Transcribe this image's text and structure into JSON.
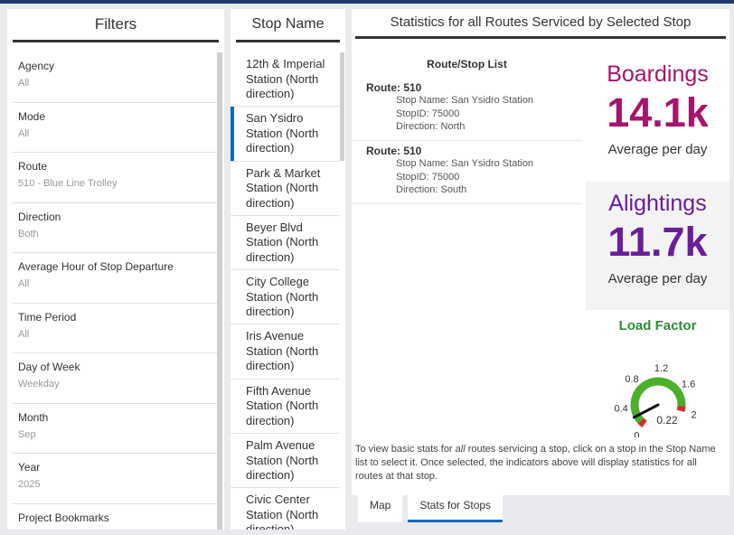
{
  "filters": {
    "title": "Filters",
    "items": [
      {
        "label": "Agency",
        "value": "All"
      },
      {
        "label": "Mode",
        "value": "All"
      },
      {
        "label": "Route",
        "value": "510 - Blue Line Trolley"
      },
      {
        "label": "Direction",
        "value": "Both"
      },
      {
        "label": "Average Hour of Stop Departure",
        "value": "All"
      },
      {
        "label": "Time Period",
        "value": "All"
      },
      {
        "label": "Day of Week",
        "value": "Weekday"
      },
      {
        "label": "Month",
        "value": "Sep"
      },
      {
        "label": "Year",
        "value": "2025"
      },
      {
        "label": "Project Bookmarks",
        "value": ""
      }
    ]
  },
  "stops": {
    "title": "Stop Name",
    "items": [
      {
        "label": "12th & Imperial Station (North direction)",
        "selected": false
      },
      {
        "label": "San Ysidro Station (North direction)",
        "selected": true
      },
      {
        "label": "Park & Market Station (North direction)",
        "selected": false
      },
      {
        "label": "Beyer Blvd Station (North direction)",
        "selected": false
      },
      {
        "label": "City College Station (North direction)",
        "selected": false
      },
      {
        "label": "Iris Avenue Station (North direction)",
        "selected": false
      },
      {
        "label": "Fifth Avenue Station (North direction)",
        "selected": false
      },
      {
        "label": "Palm Avenue Station (North direction)",
        "selected": false
      },
      {
        "label": "Civic Center Station (North direction)",
        "selected": false
      }
    ]
  },
  "stats": {
    "title": "Statistics for all Routes Serviced by Selected Stop",
    "route_list": {
      "title": "Route/Stop List",
      "routes": [
        {
          "route": "Route: 510",
          "stop_name": "Stop Name: San Ysidro Station",
          "stop_id": "StopID: 75000",
          "direction": "Direction: North"
        },
        {
          "route": "Route: 510",
          "stop_name": "Stop Name: San Ysidro Station",
          "stop_id": "StopID: 75000",
          "direction": "Direction: South"
        }
      ]
    },
    "boardings": {
      "title": "Boardings",
      "value": "14.1k",
      "subtitle": "Average per day",
      "color": "#a6146c"
    },
    "alightings": {
      "title": "Alightings",
      "value": "11.7k",
      "subtitle": "Average per day",
      "color": "#6a1e9a"
    },
    "load_factor": {
      "title": "Load Factor",
      "value": 0.22,
      "value_label": "0.22",
      "min": 0,
      "max": 2,
      "tick_labels": [
        "0",
        "0.4",
        "0.8",
        "1.2",
        "1.6",
        "2"
      ],
      "colors": {
        "green": "#4caf2a",
        "red": "#d32f2f",
        "needle": "#111111"
      }
    },
    "hint": {
      "before": "To view basic stats for ",
      "emphasis": "all",
      "after": " routes servicing a stop, click on a stop in the Stop Name list to select it.  Once selected, the indicators above will display statistics for all routes at that stop."
    }
  },
  "tabs": [
    {
      "label": "Map",
      "active": false
    },
    {
      "label": "Stats for Stops",
      "active": true
    }
  ]
}
